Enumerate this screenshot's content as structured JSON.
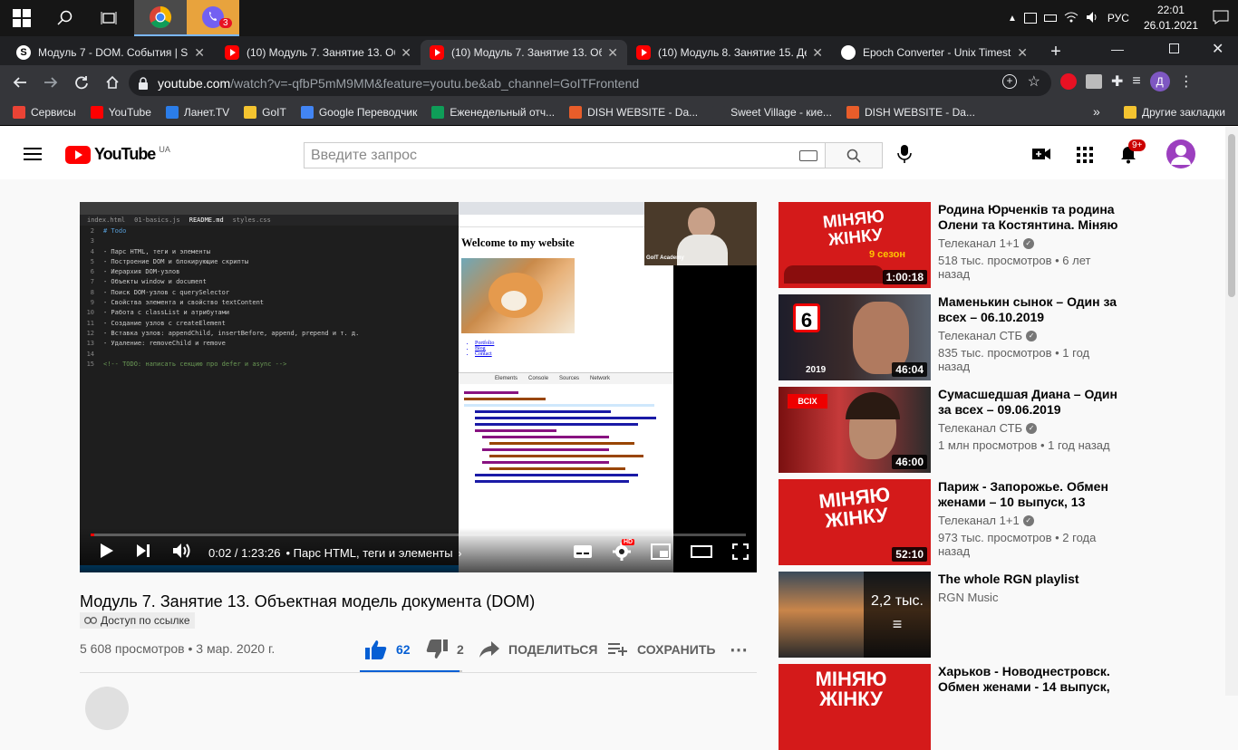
{
  "taskbar": {
    "lang": "РУС",
    "time": "22:01",
    "date": "26.01.2021",
    "viber_badge": "3"
  },
  "tabs": [
    {
      "title": "Модуль 7 - DOM. События | S",
      "icon": "site-s-icon"
    },
    {
      "title": "(10) Модуль 7. Занятие 13. Об",
      "icon": "youtube-icon"
    },
    {
      "title": "(10) Модуль 7. Занятие 13. Об",
      "icon": "youtube-icon",
      "active": true
    },
    {
      "title": "(10) Модуль 8. Занятие 15. Де",
      "icon": "youtube-icon"
    },
    {
      "title": "Epoch Converter - Unix Timest",
      "icon": "epoch-icon"
    }
  ],
  "address": {
    "host": "youtube.com",
    "path": "/watch?v=-qfbP5mM9MM&feature=youtu.be&ab_channel=GoITFrontend",
    "profile_letter": "Д"
  },
  "bookmarks": [
    {
      "label": "Сервисы",
      "color": "#ea4335"
    },
    {
      "label": "YouTube",
      "color": "#ff0000"
    },
    {
      "label": "Ланет.TV",
      "color": "#2b7de9"
    },
    {
      "label": "GoIT",
      "color": "#f4c430"
    },
    {
      "label": "Google Переводчик",
      "color": "#4285f4"
    },
    {
      "label": "Еженедельный отч...",
      "color": "#0f9d58"
    },
    {
      "label": "DISH WEBSITE - Da...",
      "color": "#e85d2a"
    },
    {
      "label": "Sweet Village - кие...",
      "color": "#35363a"
    },
    {
      "label": "DISH WEBSITE - Da...",
      "color": "#e85d2a"
    }
  ],
  "bookmarks_more": "»",
  "bookmarks_other": "Другие закладки",
  "youtube": {
    "logo": "YouTube",
    "region": "UA",
    "search_placeholder": "Введите запрос",
    "notif_count": "9+"
  },
  "player": {
    "time": "0:02 / 1:23:26",
    "chapter": "• Парс HTML, теги и элементы",
    "progress_fraction": 0.0004,
    "editor_tabs": [
      "index.html",
      "01-basics.js",
      "README.md",
      "styles.css"
    ],
    "editor_lines": [
      {
        "n": "2",
        "text": "# Todo"
      },
      {
        "n": "3",
        "text": ""
      },
      {
        "n": "4",
        "text": "- Парс HTML, теги и элементы"
      },
      {
        "n": "5",
        "text": "- Построение DOM и блокирующие скрипты"
      },
      {
        "n": "6",
        "text": "- Иерархия DOM-узлов"
      },
      {
        "n": "7",
        "text": "- Объекты window и document"
      },
      {
        "n": "8",
        "text": "- Поиск DOM-узлов с querySelector"
      },
      {
        "n": "9",
        "text": "- Свойства элемента и свойство textContent"
      },
      {
        "n": "10",
        "text": "- Работа с classList и атрибутами"
      },
      {
        "n": "11",
        "text": "- Создание узлов с createElement"
      },
      {
        "n": "12",
        "text": "- Вставка узлов: appendChild, insertBefore, append, prepend и т. д."
      },
      {
        "n": "13",
        "text": "- Удаление: removeChild и remove"
      },
      {
        "n": "14",
        "text": ""
      },
      {
        "n": "15",
        "text": "<!-- TODO: написать секцию про defer и async -->"
      }
    ],
    "page_heading": "Welcome to my website",
    "page_links": [
      "Portfolio",
      "Blog",
      "Contact"
    ],
    "devtools_tabs": [
      "Elements",
      "Console",
      "Sources",
      "Network"
    ],
    "webcam_label": "GoIT Academy"
  },
  "video": {
    "title": "Модуль 7. Занятие 13. Объектная модель документа (DOM)",
    "access": "Доступ по ссылке",
    "views": "5 608 просмотров • 3 мар. 2020 г.",
    "likes": "62",
    "dislikes": "2",
    "share": "ПОДЕЛИТЬСЯ",
    "save": "СОХРАНИТЬ",
    "like_fraction": 0.97
  },
  "recommendations": [
    {
      "title": "Родина Юрченків та родина Олени та Костянтина. Міняю ...",
      "channel": "Телеканал 1+1",
      "verified": true,
      "meta": "518 тыс. просмотров • 6 лет назад",
      "duration": "1:00:18"
    },
    {
      "title": "Маменькин сынок – Один за всех – 06.10.2019",
      "channel": "Телеканал СТБ",
      "verified": true,
      "meta": "835 тыс. просмотров • 1 год назад",
      "duration": "46:04"
    },
    {
      "title": "Сумасшедшая Диана – Один за всех – 09.06.2019",
      "channel": "Телеканал СТБ",
      "verified": true,
      "meta": "1 млн просмотров • 1 год назад",
      "duration": "46:00"
    },
    {
      "title": "Париж - Запорожье. Обмен женами – 10 выпуск, 13 сезон",
      "channel": "Телеканал 1+1",
      "verified": true,
      "meta": "973 тыс. просмотров • 2 года назад",
      "duration": "52:10"
    },
    {
      "title": "The whole RGN playlist",
      "channel": "RGN Music",
      "verified": false,
      "meta": "",
      "duration": "",
      "playlist_count": "2,2 тыс."
    },
    {
      "title": "Харьков - Новоднестровск. Обмен женами - 14 выпуск, ...",
      "channel": "",
      "verified": false,
      "meta": "",
      "duration": ""
    }
  ],
  "thumb_texts": {
    "minyayu": "МІНЯЮ ЖІНКУ",
    "season9": "9 сезон",
    "ch6": "6",
    "year2019": "2019",
    "odin_za_vseh": "ВСІХ"
  }
}
